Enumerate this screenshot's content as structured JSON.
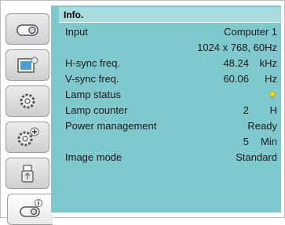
{
  "panel": {
    "title": "Info."
  },
  "sidebar": {
    "items": [
      {
        "icon": "display-icon"
      },
      {
        "icon": "color-settings-icon"
      },
      {
        "icon": "gear-icon"
      },
      {
        "icon": "gear-plus-icon"
      },
      {
        "icon": "usb-icon"
      },
      {
        "icon": "info-icon",
        "active": true
      }
    ]
  },
  "info": {
    "input": {
      "label": "Input",
      "value": "Computer 1",
      "detail": "1024 x 768, 60Hz"
    },
    "hsync": {
      "label": "H-sync freq.",
      "value": "48.24",
      "unit": "kHz"
    },
    "vsync": {
      "label": "V-sync freq.",
      "value": "60.06",
      "unit": "Hz"
    },
    "lamp_status": {
      "label": "Lamp status",
      "indicator_color": "#f2d800"
    },
    "lamp_counter": {
      "label": "Lamp counter",
      "value": "2",
      "unit": "H"
    },
    "power_management": {
      "label": "Power management",
      "value": "Ready",
      "time_value": "5",
      "time_unit": "Min"
    },
    "image_mode": {
      "label": "Image mode",
      "value": "Standard"
    }
  },
  "colors": {
    "panel": "#7ec9cd",
    "title_bar": "#a8dde0"
  }
}
